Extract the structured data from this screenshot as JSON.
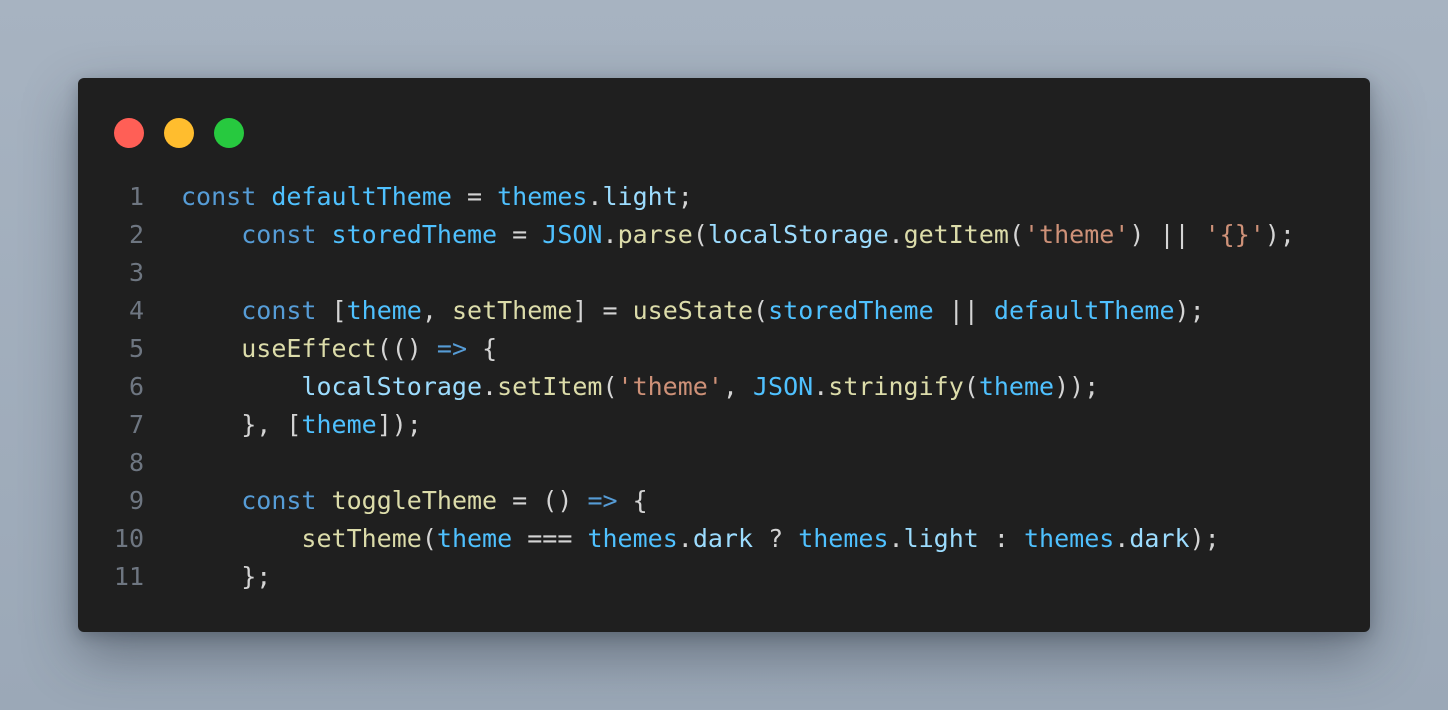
{
  "window": {
    "controls": {
      "close_color": "#ff5f56",
      "minimize_color": "#ffbd2e",
      "maximize_color": "#27c93f"
    }
  },
  "editor": {
    "line_numbers": [
      "1",
      "2",
      "3",
      "4",
      "5",
      "6",
      "7",
      "8",
      "9",
      "10",
      "11"
    ],
    "lines": [
      {
        "indent": "",
        "tokens": [
          {
            "t": "kw",
            "v": "const"
          },
          {
            "t": "op",
            "v": " "
          },
          {
            "t": "var",
            "v": "defaultTheme"
          },
          {
            "t": "op",
            "v": " = "
          },
          {
            "t": "var",
            "v": "themes"
          },
          {
            "t": "op",
            "v": "."
          },
          {
            "t": "prop",
            "v": "light"
          },
          {
            "t": "op",
            "v": ";"
          }
        ]
      },
      {
        "indent": "    ",
        "tokens": [
          {
            "t": "kw",
            "v": "const"
          },
          {
            "t": "op",
            "v": " "
          },
          {
            "t": "var",
            "v": "storedTheme"
          },
          {
            "t": "op",
            "v": " = "
          },
          {
            "t": "var",
            "v": "JSON"
          },
          {
            "t": "op",
            "v": "."
          },
          {
            "t": "fn",
            "v": "parse"
          },
          {
            "t": "op",
            "v": "("
          },
          {
            "t": "prop",
            "v": "localStorage"
          },
          {
            "t": "op",
            "v": "."
          },
          {
            "t": "fn",
            "v": "getItem"
          },
          {
            "t": "op",
            "v": "("
          },
          {
            "t": "str",
            "v": "'theme'"
          },
          {
            "t": "op",
            "v": ") || "
          },
          {
            "t": "str",
            "v": "'{}'"
          },
          {
            "t": "op",
            "v": ");"
          }
        ]
      },
      {
        "indent": "",
        "tokens": []
      },
      {
        "indent": "    ",
        "tokens": [
          {
            "t": "kw",
            "v": "const"
          },
          {
            "t": "op",
            "v": " ["
          },
          {
            "t": "var",
            "v": "theme"
          },
          {
            "t": "op",
            "v": ", "
          },
          {
            "t": "fn",
            "v": "setTheme"
          },
          {
            "t": "op",
            "v": "] = "
          },
          {
            "t": "fn",
            "v": "useState"
          },
          {
            "t": "op",
            "v": "("
          },
          {
            "t": "var",
            "v": "storedTheme"
          },
          {
            "t": "op",
            "v": " || "
          },
          {
            "t": "var",
            "v": "defaultTheme"
          },
          {
            "t": "op",
            "v": ");"
          }
        ]
      },
      {
        "indent": "    ",
        "tokens": [
          {
            "t": "fn",
            "v": "useEffect"
          },
          {
            "t": "op",
            "v": "(() "
          },
          {
            "t": "arrow",
            "v": "=>"
          },
          {
            "t": "op",
            "v": " {"
          }
        ]
      },
      {
        "indent": "        ",
        "tokens": [
          {
            "t": "prop",
            "v": "localStorage"
          },
          {
            "t": "op",
            "v": "."
          },
          {
            "t": "fn",
            "v": "setItem"
          },
          {
            "t": "op",
            "v": "("
          },
          {
            "t": "str",
            "v": "'theme'"
          },
          {
            "t": "op",
            "v": ", "
          },
          {
            "t": "var",
            "v": "JSON"
          },
          {
            "t": "op",
            "v": "."
          },
          {
            "t": "fn",
            "v": "stringify"
          },
          {
            "t": "op",
            "v": "("
          },
          {
            "t": "var",
            "v": "theme"
          },
          {
            "t": "op",
            "v": "));"
          }
        ]
      },
      {
        "indent": "    ",
        "tokens": [
          {
            "t": "op",
            "v": "}, ["
          },
          {
            "t": "var",
            "v": "theme"
          },
          {
            "t": "op",
            "v": "]);"
          }
        ]
      },
      {
        "indent": "",
        "tokens": []
      },
      {
        "indent": "    ",
        "tokens": [
          {
            "t": "kw",
            "v": "const"
          },
          {
            "t": "op",
            "v": " "
          },
          {
            "t": "fn",
            "v": "toggleTheme"
          },
          {
            "t": "op",
            "v": " = () "
          },
          {
            "t": "arrow",
            "v": "=>"
          },
          {
            "t": "op",
            "v": " {"
          }
        ]
      },
      {
        "indent": "        ",
        "tokens": [
          {
            "t": "fn",
            "v": "setTheme"
          },
          {
            "t": "op",
            "v": "("
          },
          {
            "t": "var",
            "v": "theme"
          },
          {
            "t": "op",
            "v": " === "
          },
          {
            "t": "var",
            "v": "themes"
          },
          {
            "t": "op",
            "v": "."
          },
          {
            "t": "prop",
            "v": "dark"
          },
          {
            "t": "op",
            "v": " ? "
          },
          {
            "t": "var",
            "v": "themes"
          },
          {
            "t": "op",
            "v": "."
          },
          {
            "t": "prop",
            "v": "light"
          },
          {
            "t": "op",
            "v": " : "
          },
          {
            "t": "var",
            "v": "themes"
          },
          {
            "t": "op",
            "v": "."
          },
          {
            "t": "prop",
            "v": "dark"
          },
          {
            "t": "op",
            "v": ");"
          }
        ]
      },
      {
        "indent": "    ",
        "tokens": [
          {
            "t": "op",
            "v": "};"
          }
        ]
      }
    ]
  }
}
